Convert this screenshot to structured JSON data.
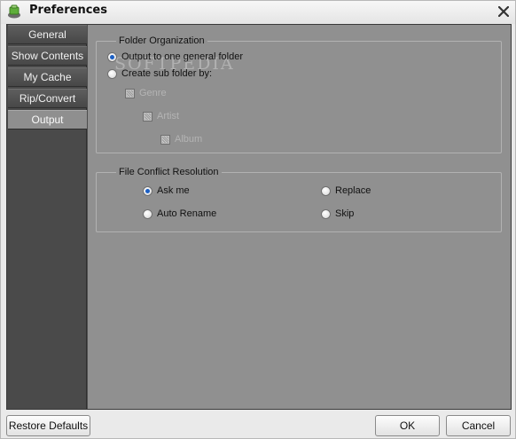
{
  "window": {
    "title": "Preferences"
  },
  "sidebar": {
    "items": [
      {
        "label": "General"
      },
      {
        "label": "Show Contents"
      },
      {
        "label": "My Cache"
      },
      {
        "label": "Rip/Convert"
      },
      {
        "label": "Output",
        "active": true
      }
    ]
  },
  "folder_org": {
    "title": "Folder Organization",
    "watermark": "SOFTPEDIA",
    "option_general": "Output to one general folder",
    "option_sub": "Create sub folder by:",
    "selected": "option_general",
    "sub": [
      {
        "label": "Genre"
      },
      {
        "label": "Artist"
      },
      {
        "label": "Album"
      }
    ]
  },
  "conflict": {
    "title": "File Conflict Resolution",
    "ask_me": "Ask me",
    "replace": "Replace",
    "auto_rename": "Auto Rename",
    "skip": "Skip",
    "selected": "ask_me"
  },
  "footer": {
    "restore": "Restore Defaults",
    "ok": "OK",
    "cancel": "Cancel"
  },
  "colors": {
    "panel_bg": "#909090",
    "sidebar_bg": "#4a4a4a",
    "radio_selected": "#1b5fc4"
  },
  "icons": {
    "title": "preferences-app-icon",
    "close": "close-icon"
  }
}
